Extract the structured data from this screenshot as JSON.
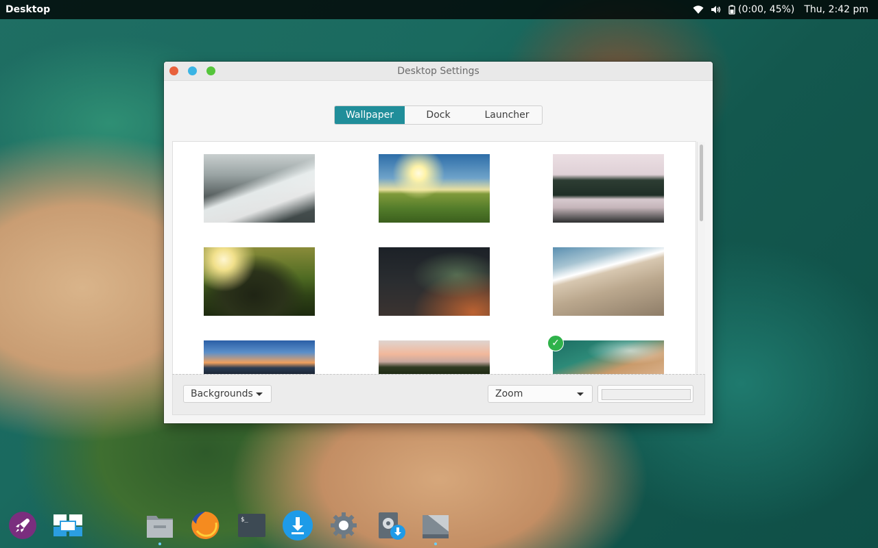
{
  "panel": {
    "desktop_label": "Desktop",
    "battery_text": "(0:00, 45%)",
    "clock": "Thu, 2:42 pm"
  },
  "window": {
    "title": "Desktop Settings"
  },
  "tabs": [
    {
      "label": "Wallpaper",
      "selected": true
    },
    {
      "label": "Dock",
      "selected": false
    },
    {
      "label": "Launcher",
      "selected": false
    }
  ],
  "wallpapers": [
    {
      "name": "waterfall",
      "selected": false
    },
    {
      "name": "windmill",
      "selected": false
    },
    {
      "name": "forest-lake",
      "selected": false
    },
    {
      "name": "rock-sunlight",
      "selected": false
    },
    {
      "name": "night-sky",
      "selected": false
    },
    {
      "name": "beach-footprints",
      "selected": false
    },
    {
      "name": "lake-sunset",
      "selected": false
    },
    {
      "name": "palm-sunset",
      "selected": false
    },
    {
      "name": "aerial-coast",
      "selected": true
    }
  ],
  "toolbar": {
    "backgrounds_label": "Backgrounds",
    "zoom_label": "Zoom"
  },
  "dock": {
    "items": [
      {
        "name": "launcher-icon"
      },
      {
        "name": "multitasking-icon"
      },
      {
        "name": "files-icon"
      },
      {
        "name": "firefox-icon"
      },
      {
        "name": "terminal-icon"
      },
      {
        "name": "downloader-icon"
      },
      {
        "name": "settings-icon"
      },
      {
        "name": "software-center-icon"
      },
      {
        "name": "desktop-settings-icon"
      }
    ]
  },
  "colors": {
    "accent": "#208e9a",
    "close": "#e8613c",
    "minimize": "#3ab4e4",
    "maximize": "#55c53b",
    "selected_check": "#2fb24a"
  }
}
